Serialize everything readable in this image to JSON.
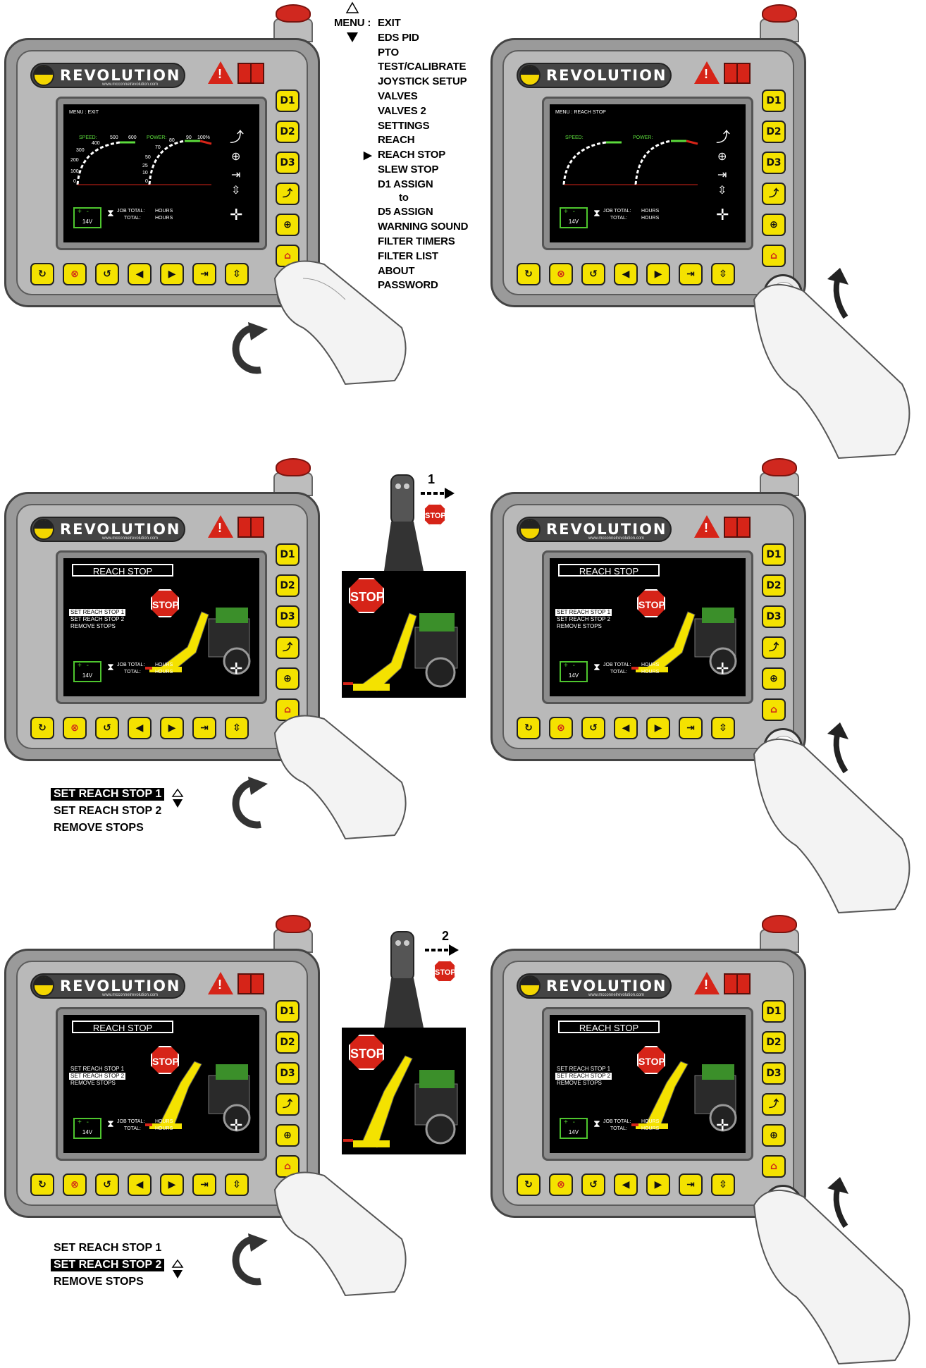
{
  "menu": {
    "label": "MENU :",
    "items": [
      "EXIT",
      "EDS PID",
      "PTO",
      "TEST/CALIBRATE",
      "JOYSTICK SETUP",
      "VALVES",
      "VALVES 2",
      "SETTINGS",
      "REACH",
      "REACH STOP",
      "SLEW STOP",
      "D1 ASSIGN",
      "to",
      "D5 ASSIGN",
      "WARNING SOUND",
      "FILTER TIMERS",
      "FILTER LIST",
      "ABOUT",
      "PASSWORD"
    ],
    "selected": "REACH STOP"
  },
  "device": {
    "brand": "REVOLUTION",
    "website": "www.mcconnelrevolution.com",
    "side_keys": [
      "D1",
      "D2",
      "D3"
    ],
    "battery": "14V",
    "job_total_label": "JOB TOTAL:",
    "total_label": "TOTAL:",
    "hours_label": "HOURS"
  },
  "screen1": {
    "menu_line": "MENU : EXIT",
    "speed_label": "SPEED:",
    "speed_ticks": [
      "0",
      "100",
      "200",
      "300",
      "400",
      "500",
      "600"
    ],
    "power_label": "POWER:",
    "power_ticks": [
      "0",
      "10",
      "25",
      "50",
      "70",
      "80",
      "90",
      "100%"
    ]
  },
  "screen2": {
    "menu_line": "MENU : REACH STOP"
  },
  "reach_screen": {
    "title": "REACH STOP",
    "options": [
      "SET REACH STOP 1",
      "SET REACH STOP 2",
      "REMOVE STOPS"
    ],
    "stop_text": "STOP"
  },
  "row2_options": {
    "items": [
      "SET REACH STOP 1",
      "SET REACH STOP 2",
      "REMOVE STOPS"
    ],
    "selected_index": 0
  },
  "row3_options": {
    "items": [
      "SET REACH STOP 1",
      "SET REACH STOP 2",
      "REMOVE STOPS"
    ],
    "selected_index": 1
  },
  "joystick1": {
    "step": "1",
    "stop_text": "STOP"
  },
  "joystick2": {
    "step": "2",
    "stop_text": "STOP"
  }
}
